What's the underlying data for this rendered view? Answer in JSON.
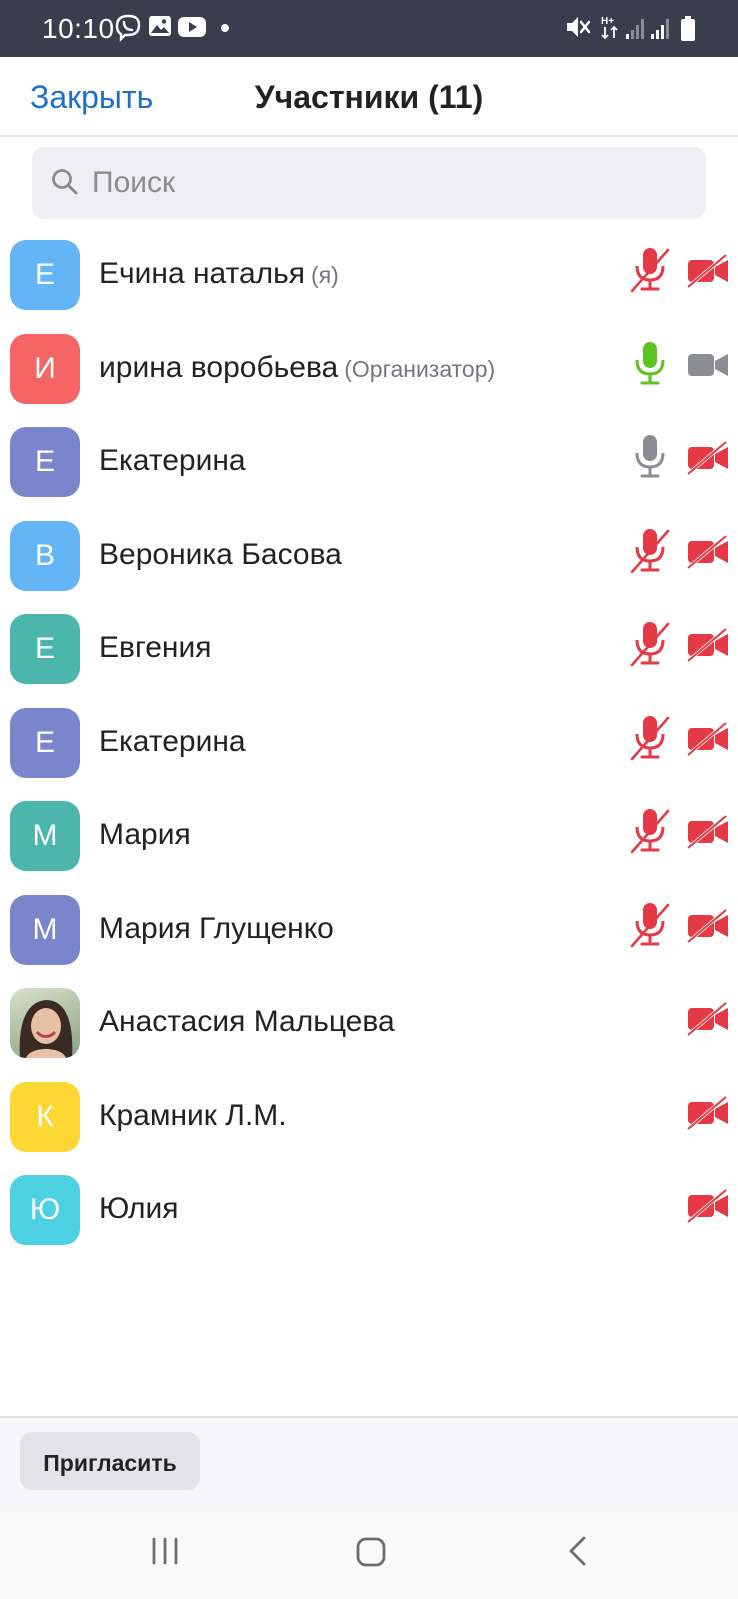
{
  "status_bar": {
    "time": "10:10",
    "left_icons": [
      "viber-icon",
      "gallery-icon",
      "youtube-icon"
    ],
    "right_icons": [
      "mute-vibrate-icon",
      "data-arrows-icon",
      "signal-icon",
      "signal-icon",
      "battery-icon"
    ]
  },
  "header": {
    "close_label": "Закрыть",
    "title": "Участники (11)"
  },
  "search": {
    "placeholder": "Поиск"
  },
  "participants": [
    {
      "initial": "Е",
      "name": "Ечина наталья",
      "role": "(я)",
      "avatar_color": "#64b5f6",
      "mic": "muted",
      "video": "off"
    },
    {
      "initial": "И",
      "name": "ирина воробьева",
      "role": "(Организатор)",
      "avatar_color": "#f56565",
      "mic": "active",
      "video": "on"
    },
    {
      "initial": "Е",
      "name": "Екатерина",
      "role": "",
      "avatar_color": "#7986cb",
      "mic": "on",
      "video": "off"
    },
    {
      "initial": "В",
      "name": "Вероника Басова",
      "role": "",
      "avatar_color": "#64b5f6",
      "mic": "muted",
      "video": "off"
    },
    {
      "initial": "Е",
      "name": "Евгения",
      "role": "",
      "avatar_color": "#4db6ac",
      "mic": "muted",
      "video": "off"
    },
    {
      "initial": "Е",
      "name": "Екатерина",
      "role": "",
      "avatar_color": "#7986cb",
      "mic": "muted",
      "video": "off"
    },
    {
      "initial": "М",
      "name": "Мария",
      "role": "",
      "avatar_color": "#4db6ac",
      "mic": "muted",
      "video": "off"
    },
    {
      "initial": "М",
      "name": "Мария Глущенко",
      "role": "",
      "avatar_color": "#7986cb",
      "mic": "muted",
      "video": "off"
    },
    {
      "initial": "",
      "name": "Анастасия Мальцева",
      "role": "",
      "avatar_color": "photo",
      "mic": "none",
      "video": "off"
    },
    {
      "initial": "К",
      "name": "Крамник Л.М.",
      "role": "",
      "avatar_color": "#fdd835",
      "mic": "none",
      "video": "off"
    },
    {
      "initial": "Ю",
      "name": "Юлия",
      "role": "",
      "avatar_color": "#4dd0e1",
      "mic": "none",
      "video": "off"
    }
  ],
  "footer": {
    "invite_label": "Пригласить"
  },
  "colors": {
    "accent": "#1e6fcd",
    "muted_red": "#e53945",
    "active_green": "#5cc31f",
    "neutral_gray": "#8c8c94",
    "status_bar_bg": "#3b3c4e"
  },
  "nav": {
    "items": [
      "recent-apps-icon",
      "home-icon",
      "back-icon"
    ]
  }
}
